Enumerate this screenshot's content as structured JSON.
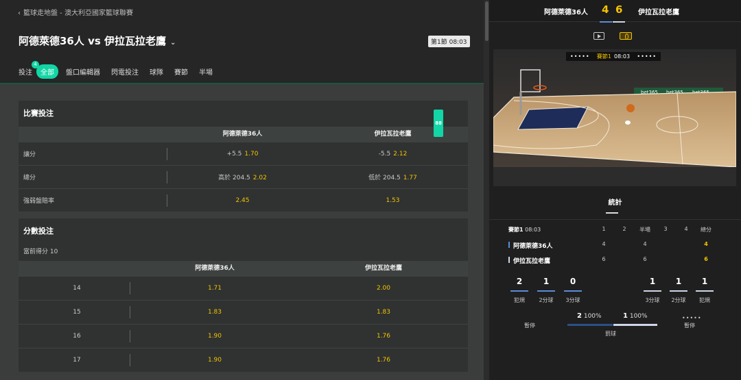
{
  "breadcrumb": "籃球走地盤 - 澳大利亞國家籃球聯賽",
  "match": {
    "title": "阿德萊德36人 vs 伊拉瓦拉老鷹",
    "period_badge": "第1節 08:03"
  },
  "tabs": [
    {
      "label": "投注",
      "count": "4"
    },
    {
      "label": "全部"
    },
    {
      "label": "盤口編輯器"
    },
    {
      "label": "閃電投注"
    },
    {
      "label": "球隊"
    },
    {
      "label": "賽節"
    },
    {
      "label": "半場"
    }
  ],
  "game_bets": {
    "title": "比賽投注",
    "badge": "88",
    "columns": [
      "阿德萊德36人",
      "伊拉瓦拉老鷹"
    ],
    "rows": [
      {
        "label": "讓分",
        "home_line": "+5.5",
        "home_odds": "1.70",
        "away_line": "-5.5",
        "away_odds": "2.12"
      },
      {
        "label": "總分",
        "home_line": "高於 204.5",
        "home_odds": "2.02",
        "away_line": "低於 204.5",
        "away_odds": "1.77"
      },
      {
        "label": "強弱盤賠率",
        "home_line": "",
        "home_odds": "2.45",
        "away_line": "",
        "away_odds": "1.53"
      }
    ]
  },
  "score_bets": {
    "title": "分數投注",
    "subtitle": "當前得分 10",
    "columns": [
      "阿德萊德36人",
      "伊拉瓦拉老鷹"
    ],
    "rows": [
      {
        "label": "14",
        "home_odds": "1.71",
        "away_odds": "2.00"
      },
      {
        "label": "15",
        "home_odds": "1.83",
        "away_odds": "1.83"
      },
      {
        "label": "16",
        "home_odds": "1.90",
        "away_odds": "1.76"
      },
      {
        "label": "17",
        "home_odds": "1.90",
        "away_odds": "1.76"
      }
    ]
  },
  "scoreboard": {
    "home": "阿德萊德36人",
    "home_score": "4",
    "away_score": "6",
    "away": "伊拉瓦拉老鷹"
  },
  "court": {
    "dots_left": "•••••",
    "period": "賽節1",
    "clock": "08:03",
    "dots_right": "•••••",
    "ad_text": "bet365",
    "ad_text_2": "bet365",
    "ad_text_3": "bet365"
  },
  "stats": {
    "tab": "統計",
    "header": {
      "period": "賽節1",
      "clock": "08:03",
      "cols": [
        "1",
        "2",
        "半場",
        "3",
        "4",
        "總分"
      ]
    },
    "teams": [
      {
        "name": "阿德萊德36人",
        "q1": "4",
        "q2": "",
        "half": "4",
        "q3": "",
        "q4": "",
        "total": "4",
        "color": "#5b8dd9"
      },
      {
        "name": "伊拉瓦拉老鷹",
        "q1": "6",
        "q2": "",
        "half": "6",
        "q3": "",
        "q4": "",
        "total": "6",
        "color": "#cfd6e8"
      }
    ],
    "home_counters": [
      {
        "value": "2",
        "label": "犯規"
      },
      {
        "value": "1",
        "label": "2分球"
      },
      {
        "value": "0",
        "label": "3分球"
      }
    ],
    "away_counters": [
      {
        "value": "1",
        "label": "3分球"
      },
      {
        "value": "1",
        "label": "2分球"
      },
      {
        "value": "1",
        "label": "犯規"
      }
    ],
    "free_throws": {
      "home_made": "2",
      "home_pct": "100%",
      "away_made": "1",
      "away_pct": "100%",
      "label": "罰球"
    },
    "timeouts": {
      "home_label": "暫停",
      "away_dots": "•••••",
      "away_label": "暫停"
    }
  },
  "colors": {
    "accent": "#12d6a5",
    "odds": "#f5c400",
    "home": "#5b8dd9",
    "away": "#cfd6e8"
  }
}
